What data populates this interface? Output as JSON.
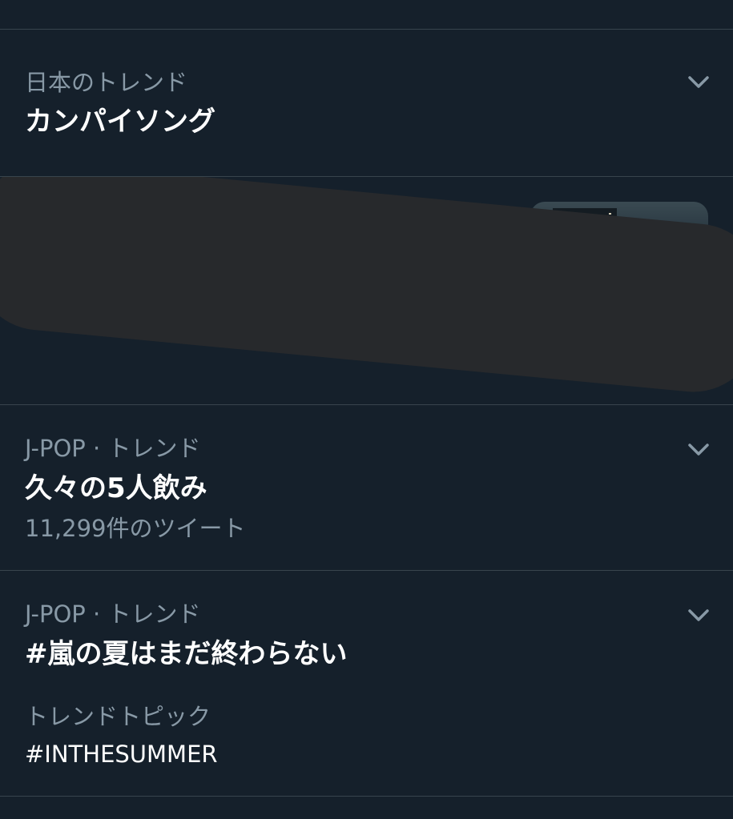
{
  "trends": [
    {
      "context": "日本のトレンド",
      "title": "カンパイソング"
    },
    {
      "context": "J-POP · トレンド",
      "title": "久々の5人飲み",
      "tweet_count": "11,299件のツイート"
    },
    {
      "context": "J-POP · トレンド",
      "title": "#嵐の夏はまだ終わらない",
      "topic_label": "トレンドトピック",
      "topic_value": "#INTHESUMMER"
    }
  ],
  "icons": {
    "more": "chevron-down-icon"
  },
  "colors": {
    "background": "#15202b",
    "divider": "#38444d",
    "secondary_text": "#8899a6",
    "primary_text": "#ffffff",
    "redaction": "#27292c"
  }
}
